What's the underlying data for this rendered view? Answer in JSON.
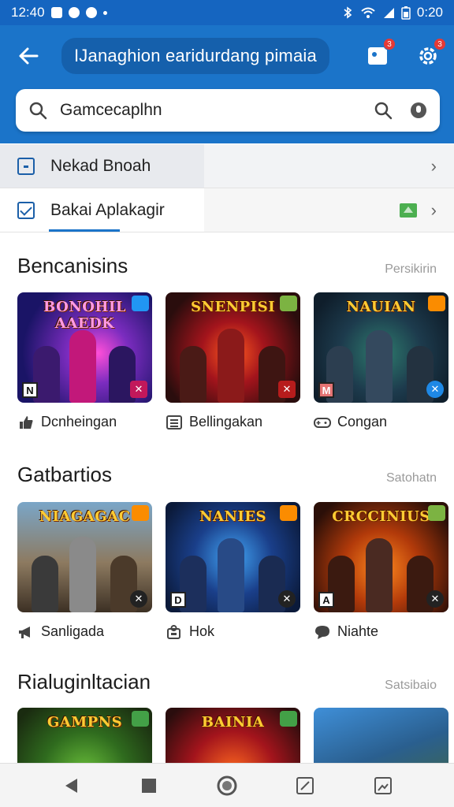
{
  "status_bar": {
    "time": "12:40",
    "clock_right": "0:20"
  },
  "app_bar": {
    "title": "IJanaghion earidurdang pimaia",
    "notifications_badge": "3",
    "settings_badge": "3"
  },
  "search": {
    "value": "Gamcecaplhn"
  },
  "filters": [
    {
      "label": "Nekad Bnoah",
      "checked": false
    },
    {
      "label": "Bakai Aplakagir",
      "checked": true
    }
  ],
  "sections": [
    {
      "title": "Bencanisins",
      "more": "Persikirin",
      "cards": [
        {
          "art": "BONOHIL AAEDK",
          "label": "Dcnheingan",
          "icon": "thumbs-up-icon",
          "bl": "N",
          "br": "✕"
        },
        {
          "art": "SNENPISI",
          "label": "Bellingakan",
          "icon": "list-icon",
          "bl": "",
          "br": "✕"
        },
        {
          "art": "NAUIAN",
          "label": "Congan",
          "icon": "controller-icon",
          "bl": "M",
          "br": "✕"
        }
      ]
    },
    {
      "title": "Gatbartios",
      "more": "Satohatn",
      "cards": [
        {
          "art": "NIAGAGAC",
          "label": "Sanligada",
          "icon": "megaphone-icon",
          "bl": "",
          "br": "✕"
        },
        {
          "art": "NANIES",
          "label": "Hok",
          "icon": "puzzle-icon",
          "bl": "D",
          "br": "✕"
        },
        {
          "art": "CRCCINIUS",
          "label": "Niahte",
          "icon": "chat-icon",
          "bl": "A",
          "br": "✕"
        }
      ]
    },
    {
      "title": "Rialuginltacian",
      "more": "Satsibaio",
      "cards": [
        {
          "art": "GAMPNS",
          "label": "",
          "icon": "",
          "bl": "",
          "br": ""
        },
        {
          "art": "BAINIA",
          "label": "",
          "icon": "",
          "bl": "",
          "br": ""
        },
        {
          "art": "",
          "label": "",
          "icon": "",
          "bl": "",
          "br": ""
        }
      ]
    }
  ],
  "colors": {
    "primary": "#1b74c9",
    "primary_dark": "#1560ac",
    "badge": "#e53935"
  }
}
